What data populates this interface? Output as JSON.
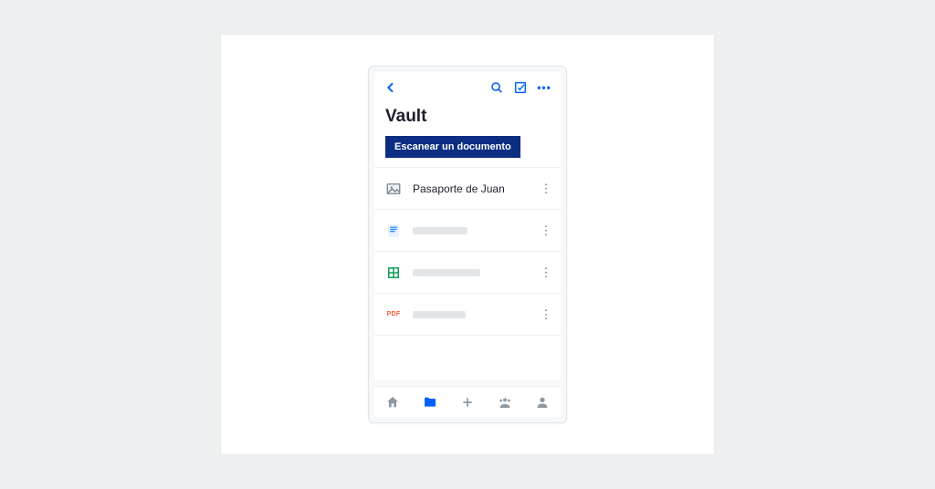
{
  "colors": {
    "accent": "#0061fe",
    "scan_button_bg": "#0b2e82",
    "page_bg": "#edeff1"
  },
  "header": {
    "title": "Vault"
  },
  "actions": {
    "scan_label": "Escanear un documento"
  },
  "files": [
    {
      "icon": "image-icon",
      "name": "Pasaporte de Juan",
      "placeholder": false
    },
    {
      "icon": "doc-icon",
      "name": "",
      "placeholder": true,
      "placeholder_width": 60
    },
    {
      "icon": "sheet-icon",
      "name": "",
      "placeholder": true,
      "placeholder_width": 74
    },
    {
      "icon": "pdf-icon",
      "name": "",
      "placeholder": true,
      "placeholder_width": 58,
      "pdf_label": "PDF"
    }
  ],
  "tabs": {
    "items": [
      "home",
      "files",
      "add",
      "photos",
      "account"
    ],
    "active": "files"
  }
}
